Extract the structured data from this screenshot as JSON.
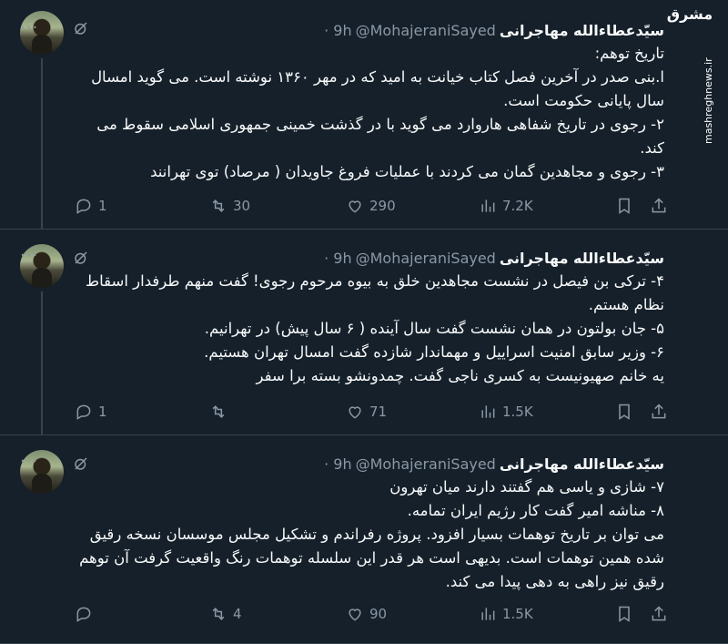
{
  "watermark": {
    "logo": "مشرق",
    "site": "mashreghnews.ir"
  },
  "tweets": [
    {
      "name": "سیّدعطاءالله مهاجرانی",
      "handle": "@MohajeraniSayed",
      "time": "· 9h",
      "text": "تاریخ توهم:\nا.بنی صدر در آخرین فصل کتاب خیانت به امید که در مهر ۱۳۶۰ نوشته است. می گوید امسال سال پایانی حکومت است.\n۲- رجوی در تاریخ شفاهی هاروارد می گوید با در گذشت خمینی جمهوری اسلامی سقوط می کند.\n۳- رجوی و مجاهدین گمان می کردند با عملیات فروغ جاویدان ( مرصاد) توی تهرانند",
      "replies": "1",
      "retweets": "30",
      "likes": "290",
      "views": "7.2K"
    },
    {
      "name": "سیّدعطاءالله مهاجرانی",
      "handle": "@MohajeraniSayed",
      "time": "· 9h",
      "text": "۴- ترکی بن فیصل در نشست مجاهدین خلق به بیوه مرحوم رجوی! گفت منهم طرفدار اسقاط نظام هستم.\n۵- جان بولتون در همان نشست گفت سال آینده ( ۶ سال پیش) در تهرانیم.\n۶- وزیر سابق امنیت اسراییل و مهماندار شازده گفت امسال تهران هستیم.\nیه خانم صهیونیست به کسری ناجی گفت. چمدونشو بسته برا سفر",
      "replies": "1",
      "retweets": "",
      "likes": "71",
      "views": "1.5K"
    },
    {
      "name": "سیّدعطاءالله مهاجرانی",
      "handle": "@MohajeraniSayed",
      "time": "· 9h",
      "text": "۷- شازی و یاسی هم گفتند دارند میان تهرون\n۸- مناشه امیر گفت کار رژیم ایران تمامه.\nمی توان بر تاریخ توهمات بسیار افزود. پروژه رفراندم و تشکیل مجلس موسسان نسخه رقیق شده همین توهمات است. بدیهی است هر قدر این سلسله توهمات رنگ واقعیت گرفت آن توهم رقیق نیز راهی به دهی پیدا می کند.",
      "replies": "",
      "retweets": "4",
      "likes": "90",
      "views": "1.5K"
    }
  ],
  "icons": {
    "reply": "reply-icon",
    "retweet": "retweet-icon",
    "like": "heart-icon",
    "views": "views-icon",
    "bookmark": "bookmark-icon",
    "share": "share-icon",
    "more": "more-icon",
    "grok": "grok-icon"
  },
  "more_glyph": "···"
}
